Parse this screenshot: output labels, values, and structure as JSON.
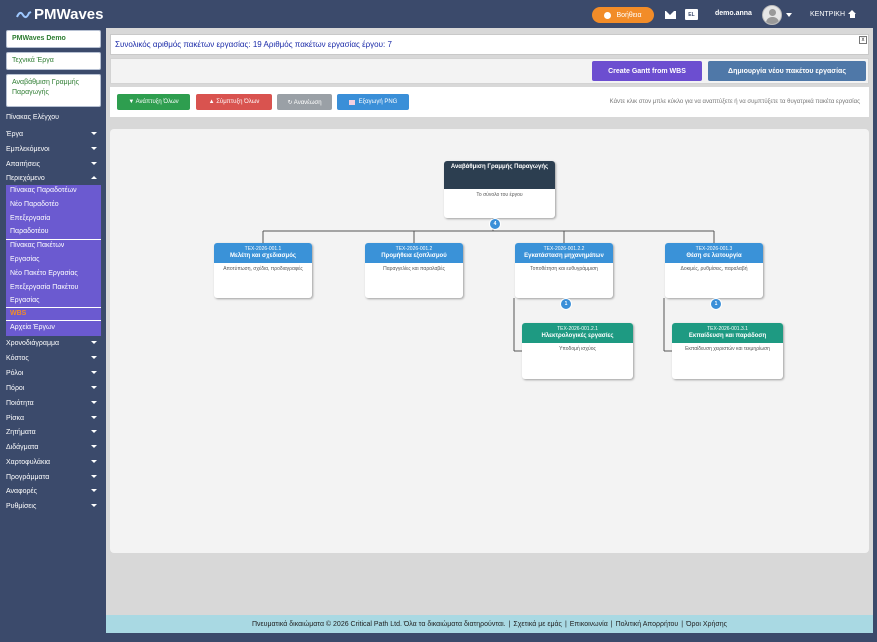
{
  "header": {
    "logo_text": "PMWaves",
    "help_label": "Βοήθεια",
    "lang_badge": "EL",
    "username": "demo.anna",
    "home_label": "ΚΕΝΤΡΙΚΗ"
  },
  "sidebar": {
    "project_name": "PMWaves Demo",
    "project_type": "Τεχνικά Έργα",
    "current_project": "Αναβάθμιση Γραμμής Παραγωγής",
    "items": [
      {
        "label": "Πίνακας Ελέγχου",
        "caret": ""
      },
      {
        "label": "Έργα",
        "caret": "down"
      },
      {
        "label": "Εμπλεκόμενοι",
        "caret": "down"
      },
      {
        "label": "Απαιτήσεις",
        "caret": "down"
      },
      {
        "label": "Περιεχόμενο",
        "caret": "up"
      }
    ],
    "submenu": [
      "Πίνακας Παραδοτέων",
      "Νέο Παραδοτέο",
      "Επεξεργασία",
      "Παραδοτέου",
      "Πίνακας Πακέτων",
      "Εργασίας",
      "Νέο Πακέτο Εργασίας",
      "Επεξεργασία Πακέτου",
      "Εργασίας",
      "WBS",
      "Αρχεία Έργων"
    ],
    "items_after": [
      {
        "label": "Χρονοδιάγραμμα"
      },
      {
        "label": "Κόστος"
      },
      {
        "label": "Ρόλοι"
      },
      {
        "label": "Πόροι"
      },
      {
        "label": "Ποιότητα"
      },
      {
        "label": "Ρίσκα"
      },
      {
        "label": "Ζητήματα"
      },
      {
        "label": "Διδάγματα"
      },
      {
        "label": "Χαρτοφυλάκια"
      },
      {
        "label": "Προγράμματα"
      },
      {
        "label": "Αναφορές"
      },
      {
        "label": "Ρυθμίσεις"
      }
    ]
  },
  "main": {
    "summary": "Συνολικός αριθμός πακέτων εργασίας: 19 Αριθμός πακέτων εργασίας έργου: 7",
    "close_label": "x",
    "gantt_button": "Create Gantt from WBS",
    "new_package_button": "Δημιουργία νέου πακέτου εργασίας",
    "expand_all": "▼ Ανάπτυξη Όλων",
    "collapse_all": "▲ Σύμπτυξη Όλων",
    "refresh": "↻ Ανανέωση",
    "export_png": "Εξαγωγή PNG",
    "hint": "Κάντε κλικ στον μπλε κύκλο για να αναπτύξετε ή να συμπτύξετε τα θυγατρικά πακέτα εργασίας"
  },
  "wbs": {
    "root": {
      "title": "Αναβάθμιση Γραμμής Παραγωγής",
      "desc": "Το σύνολο του έργου",
      "children_count": "4"
    },
    "level1": [
      {
        "code": "ΤΕΧ-2026-001.1",
        "title": "Μελέτη και σχεδιασμός",
        "desc": "Αποτύπωση, σχέδια, προδιαγραφές"
      },
      {
        "code": "ΤΕΧ-2026-001.2",
        "title": "Προμήθεια εξοπλισμού",
        "desc": "Παραγγελίες και παραλαβές"
      },
      {
        "code": "ΤΕΧ-2026-001.2.2",
        "title": "Εγκατάσταση μηχανημάτων",
        "desc": "Τοποθέτηση και ευθυγράμμιση",
        "children_count": "1"
      },
      {
        "code": "ΤΕΧ-2026-001.3",
        "title": "Θέση σε λειτουργία",
        "desc": "Δοκιμές, ρυθμίσεις, παραλαβή",
        "children_count": "1"
      }
    ],
    "level2": [
      {
        "code": "ΤΕΧ-2026-001.2.1",
        "title": "Ηλεκτρολογικές εργασίες",
        "desc": "Υποδομή ισχύος"
      },
      {
        "code": "ΤΕΧ-2026-001.3.1",
        "title": "Εκπαίδευση και παράδοση",
        "desc": "Εκπαίδευση χειριστών και τεκμηρίωση"
      }
    ]
  },
  "footer": {
    "copyright": "Πνευματικά δικαιώματα © 2026 Critical Path Ltd. Όλα τα δικαιώματα διατηρούνται.",
    "about": "Σχετικά με εμάς",
    "contact": "Επικοινωνία",
    "privacy": "Πολιτική Απορρήτου",
    "terms": "Όροι Χρήσης"
  },
  "colors": {
    "nav_bg": "#3b4a6b",
    "submenu_bg": "#6b5ad0",
    "accent_orange": "#f28c28",
    "root_node": "#2c3e50",
    "level1_node": "#3a92d8",
    "level2_node": "#1e9a82"
  }
}
